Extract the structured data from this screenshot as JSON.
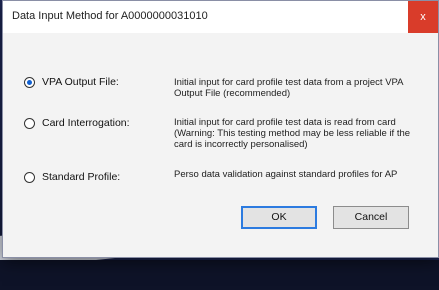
{
  "dialog": {
    "title": "Data Input Method for A0000000031010",
    "close_label": "x",
    "options": [
      {
        "label": "VPA Output File:",
        "description": "Initial input for card profile test data from a project VPA Output File (recommended)",
        "selected": true
      },
      {
        "label": "Card Interrogation:",
        "description": "Initial input for card profile test data is read from card (Warning: This testing method may be less reliable if the card is incorrectly personalised)",
        "selected": false
      },
      {
        "label": "Standard Profile:",
        "description": "Perso data validation against standard profiles for AP",
        "selected": false
      }
    ],
    "ok_label": "OK",
    "cancel_label": "Cancel"
  },
  "colors": {
    "close_button": "#d93c2a",
    "radio_selected": "#1060d0",
    "default_button_border": "#2c7be0"
  }
}
